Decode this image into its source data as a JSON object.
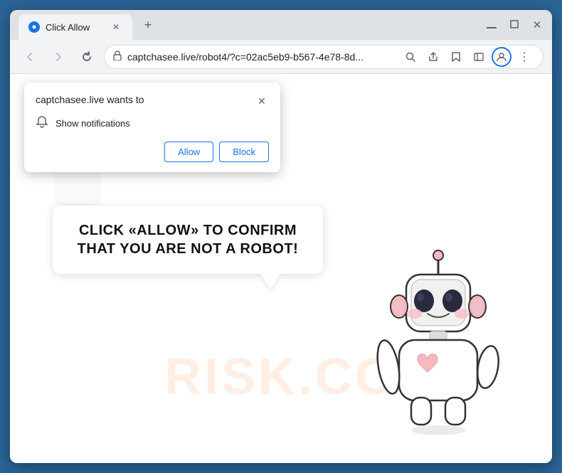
{
  "browser": {
    "tab_title": "Click Allow",
    "tab_favicon_text": "●",
    "new_tab_icon": "+",
    "window_controls": {
      "minimize": "—",
      "maximize": "□",
      "close": "✕"
    }
  },
  "navbar": {
    "back_icon": "←",
    "forward_icon": "→",
    "reload_icon": "↻",
    "address": "captchasee.live/robot4/?c=02ac5eb9-b567-4e78-8d...",
    "lock_icon": "🔒",
    "search_icon": "🔍",
    "share_icon": "⎙",
    "star_icon": "☆",
    "sidebar_icon": "▣",
    "profile_icon": "👤",
    "menu_icon": "⋮"
  },
  "popup": {
    "title": "captchasee.live wants to",
    "close_icon": "✕",
    "notification_label": "Show notifications",
    "bell_icon": "🔔",
    "allow_label": "Allow",
    "block_label": "Block"
  },
  "page": {
    "bubble_text": "CLICK «ALLOW» TO CONFIRM THAT YOU ARE NOT A ROBOT!",
    "watermark_text": "RISK.CO"
  }
}
